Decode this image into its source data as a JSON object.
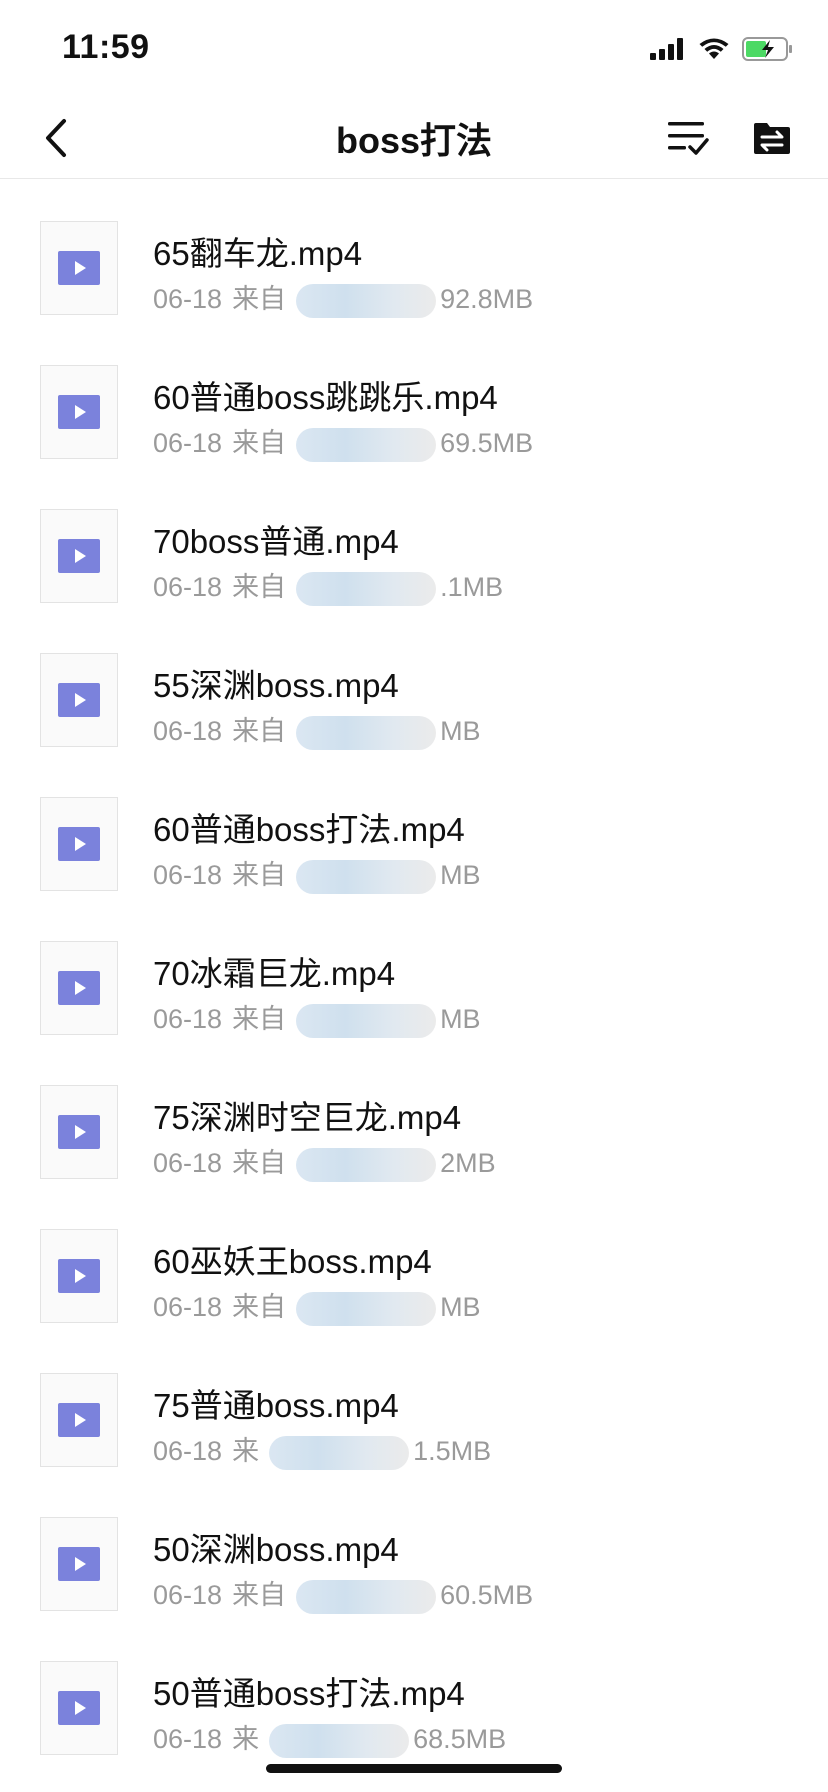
{
  "status_bar": {
    "time": "11:59"
  },
  "nav": {
    "title": "boss打法"
  },
  "files": [
    {
      "name": "65翻车龙.mp4",
      "date": "06-18",
      "from": "来自",
      "size": "92.8MB"
    },
    {
      "name": "60普通boss跳跳乐.mp4",
      "date": "06-18",
      "from": "来自",
      "size": "69.5MB"
    },
    {
      "name": "70boss普通.mp4",
      "date": "06-18",
      "from": "来自",
      "size": ".1MB"
    },
    {
      "name": "55深渊boss.mp4",
      "date": "06-18",
      "from": "来自",
      "size": "MB"
    },
    {
      "name": "60普通boss打法.mp4",
      "date": "06-18",
      "from": "来自",
      "size": "MB"
    },
    {
      "name": "70冰霜巨龙.mp4",
      "date": "06-18",
      "from": "来自",
      "size": "MB"
    },
    {
      "name": "75深渊时空巨龙.mp4",
      "date": "06-18",
      "from": "来自",
      "size": "2MB"
    },
    {
      "name": "60巫妖王boss.mp4",
      "date": "06-18",
      "from": "来自",
      "size": "MB"
    },
    {
      "name": "75普通boss.mp4",
      "date": "06-18",
      "from": "来",
      "size": "1.5MB"
    },
    {
      "name": "50深渊boss.mp4",
      "date": "06-18",
      "from": "来自",
      "size": "60.5MB"
    },
    {
      "name": "50普通boss打法.mp4",
      "date": "06-18",
      "from": "来",
      "size": "68.5MB"
    }
  ],
  "colors": {
    "accent": "#7b82dc",
    "meta_text": "#9a9a9a",
    "divider": "#e8e8e8"
  },
  "icons": {
    "back": "chevron-left-icon",
    "multi_select": "list-check-icon",
    "move_folder": "folder-transfer-icon",
    "file_type": "video-file-icon"
  }
}
